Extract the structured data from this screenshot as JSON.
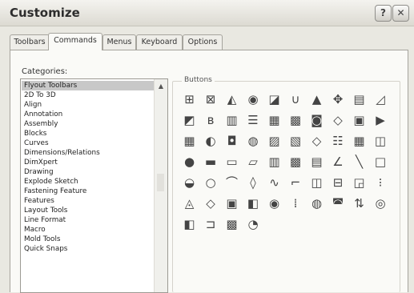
{
  "window": {
    "title": "Customize",
    "help_glyph": "?",
    "close_glyph": "✕"
  },
  "tabs": [
    {
      "label": "Toolbars",
      "active": false
    },
    {
      "label": "Commands",
      "active": true
    },
    {
      "label": "Menus",
      "active": false
    },
    {
      "label": "Keyboard",
      "active": false
    },
    {
      "label": "Options",
      "active": false
    }
  ],
  "categories": {
    "label": "Categories:",
    "selected": "Flyout Toolbars",
    "items": [
      "Flyout Toolbars",
      "2D To 3D",
      "Align",
      "Annotation",
      "Assembly",
      "Blocks",
      "Curves",
      "Dimensions/Relations",
      "DimXpert",
      "Drawing",
      "Explode Sketch",
      "Fastening Feature",
      "Features",
      "Layout Tools",
      "Line Format",
      "Macro",
      "Mold Tools",
      "Quick Snaps"
    ]
  },
  "buttons": {
    "label": "Buttons",
    "icons": [
      [
        "frame-icon",
        "snap-icon",
        "dimension-icon",
        "rotate-view-icon",
        "sketch-picture-icon",
        "spline-icon",
        "reference-geometry-icon",
        "move-entity-icon",
        "drawing-view-icon",
        "linear-pattern-icon"
      ],
      [
        "display-icon",
        "equation-icon",
        "layer-icon",
        "line-format-icon",
        "shaded-view-icon",
        "section-view-icon",
        "mirror-icon",
        "align-icon",
        "assembly-icon",
        "measure-icon"
      ],
      [
        "extrude-icon",
        "revolve-icon",
        "shell-icon",
        "annotation-icon",
        "mate-icon",
        "explode-icon",
        "plane-icon",
        "table-icon",
        "block-icon",
        "sheet-icon"
      ],
      [
        "circle-icon",
        "graph-icon",
        "part-icon",
        "note-icon",
        "save-icon",
        "pattern-icon",
        "surface-icon",
        "corner-icon",
        "line-icon",
        "rectangle-icon"
      ],
      [
        "slot-icon",
        "center-mark-icon",
        "arc-icon",
        "sketch-curve-icon",
        "wave-icon",
        "hook-icon",
        "fillet-icon",
        "weld-icon",
        "hole-icon",
        "grid-icon"
      ],
      [
        "datum-icon",
        "diamond-icon",
        "balloon-icon",
        "library-icon",
        "gear-icon",
        "multi-icon",
        "camera-icon",
        "chat-icon",
        "split-icon",
        "ring-icon"
      ],
      [
        "photo-icon",
        "bracket-icon",
        "palette-icon",
        "macro-icon"
      ]
    ],
    "glyphs": [
      [
        "⊞",
        "⊠",
        "◭",
        "◉",
        "◪",
        "∪",
        "▲",
        "✥",
        "▤",
        "◿"
      ],
      [
        "◩",
        "ʙ",
        "▥",
        "☰",
        "▦",
        "▩",
        "◙",
        "◇",
        "▣",
        "▶"
      ],
      [
        "▦",
        "◐",
        "◘",
        "◍",
        "▨",
        "▧",
        "◇",
        "☷",
        "▦",
        "◫"
      ],
      [
        "●",
        "▬",
        "▭",
        "▱",
        "▥",
        "▩",
        "▤",
        "∠",
        "╲",
        "□"
      ],
      [
        "◒",
        "○",
        "⌒",
        "◊",
        "∿",
        "⌐",
        "◫",
        "⊟",
        "◲",
        "⁝"
      ],
      [
        "◬",
        "◇",
        "▣",
        "◧",
        "◉",
        "⁞",
        "◍",
        "◚",
        "⇅",
        "◎"
      ],
      [
        "◧",
        "⊐",
        "▩",
        "◔"
      ]
    ]
  }
}
